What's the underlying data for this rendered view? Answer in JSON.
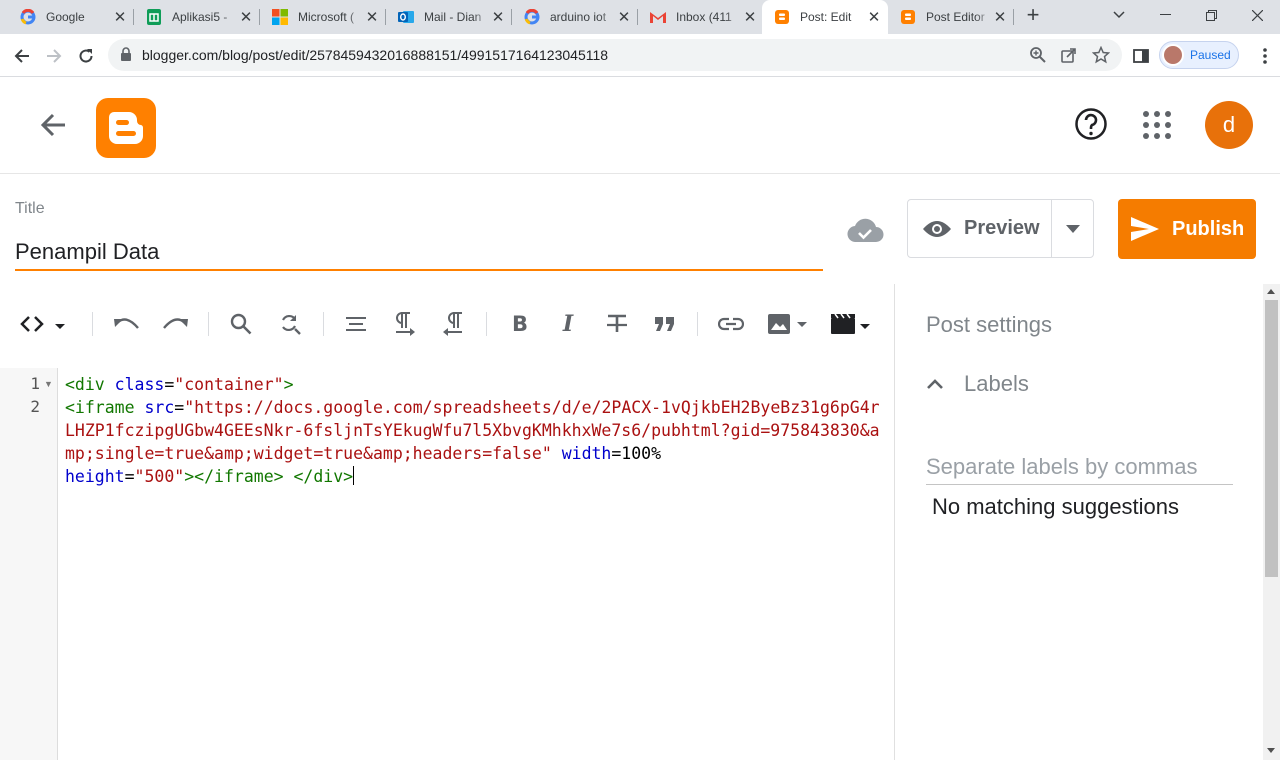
{
  "browser": {
    "tabs": [
      {
        "title": "Google",
        "icon": "google-icon"
      },
      {
        "title": "Aplikasi5 -",
        "icon": "sheets-icon"
      },
      {
        "title": "Microsoft (",
        "icon": "microsoft-icon"
      },
      {
        "title": "Mail - Dian",
        "icon": "outlook-icon"
      },
      {
        "title": "arduino iot",
        "icon": "google-icon"
      },
      {
        "title": "Inbox (411",
        "icon": "gmail-icon"
      },
      {
        "title": "Post: Edit",
        "icon": "blogger-icon"
      },
      {
        "title": "Post Editor",
        "icon": "blogger-icon"
      }
    ],
    "active_tab": 6,
    "url": "blogger.com/blog/post/edit/2578459432016888151/4991517164123045118",
    "profile_status": "Paused"
  },
  "header": {
    "user_initial": "d"
  },
  "post": {
    "title_label": "Title",
    "title_value": "Penampil Data",
    "preview_label": "Preview",
    "publish_label": "Publish"
  },
  "editor": {
    "line_numbers": [
      "1",
      "2"
    ],
    "code": {
      "l1_open": "<div",
      "l1_attr": " class",
      "l1_eq": "=",
      "l1_val": "\"container\"",
      "l1_close": ">",
      "l2_open": "<iframe",
      "l2_attr_src": " src",
      "l2_eq1": "=",
      "l2_src_val": "\"https://docs.google.com/spreadsheets/d/e/2PACX-1vQjkbEH2ByeBz31g6pG4rLHZP1fczipgUGbw4GEEsNkr-6fsljnTsYEkugWfu7l5XbvgKMhkhxWe7s6/pubhtml?gid=975843830&amp;single=true&amp;widget=true&amp;headers=false\"",
      "l2_attr_width": " width",
      "l2_eq2": "=100%",
      "l2_attr_height": "height",
      "l2_eq3": "=",
      "l2_height_val": "\"500\"",
      "l2_close": "></iframe>",
      "l2_space": " ",
      "l2_div_close": "</div>"
    }
  },
  "sidebar": {
    "title": "Post settings",
    "labels_header": "Labels",
    "labels_placeholder": "Separate labels by commas",
    "no_match": "No matching suggestions"
  },
  "colors": {
    "accent": "#f57c00",
    "logo": "#ff8000",
    "avatar": "#e8710a"
  }
}
